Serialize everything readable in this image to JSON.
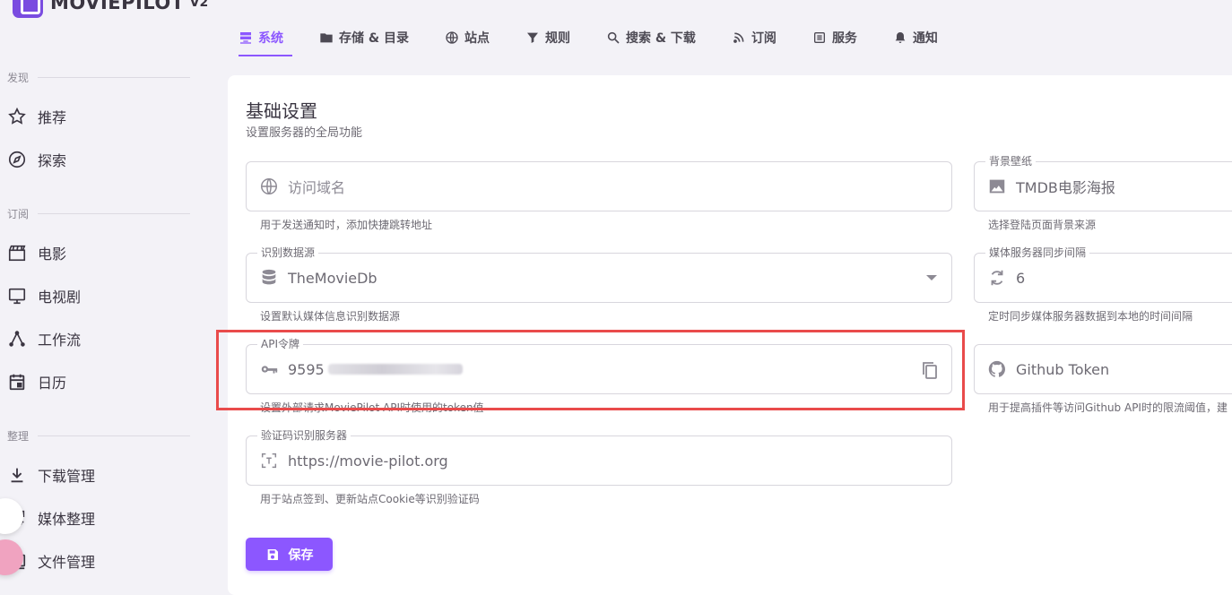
{
  "brand": {
    "name": "MOVIEPILOT",
    "version": "V2"
  },
  "sidebar": {
    "sections": [
      {
        "label": "发现"
      },
      {
        "label": "订阅"
      },
      {
        "label": "整理"
      }
    ],
    "items": [
      {
        "label": "推荐",
        "icon": "star-icon"
      },
      {
        "label": "探索",
        "icon": "compass-icon"
      },
      {
        "label": "电影",
        "icon": "clapper-icon"
      },
      {
        "label": "电视剧",
        "icon": "tv-icon"
      },
      {
        "label": "工作流",
        "icon": "workflow-icon"
      },
      {
        "label": "日历",
        "icon": "calendar-icon"
      },
      {
        "label": "下载管理",
        "icon": "download-icon"
      },
      {
        "label": "媒体整理",
        "icon": "organize-icon"
      },
      {
        "label": "文件管理",
        "icon": "file-manager-icon"
      }
    ]
  },
  "tabs": [
    {
      "label": "系统",
      "active": true
    },
    {
      "label": "存储 & 目录"
    },
    {
      "label": "站点"
    },
    {
      "label": "规则"
    },
    {
      "label": "搜索 & 下载"
    },
    {
      "label": "订阅"
    },
    {
      "label": "服务"
    },
    {
      "label": "通知"
    }
  ],
  "card": {
    "title": "基础设置",
    "subtitle": "设置服务器的全局功能"
  },
  "fields": {
    "domain": {
      "placeholder": "访问域名",
      "hint": "用于发送通知时，添加快捷跳转地址"
    },
    "wallpaper": {
      "label": "背景壁纸",
      "value": "TMDB电影海报",
      "hint": "选择登陆页面背景来源"
    },
    "datasource": {
      "label": "识别数据源",
      "value": "TheMovieDb",
      "hint": "设置默认媒体信息识别数据源"
    },
    "sync_interval": {
      "label": "媒体服务器同步间隔",
      "value": "6",
      "hint": "定时同步媒体服务器数据到本地的时间间隔"
    },
    "api_token": {
      "label": "API令牌",
      "value": "9595",
      "hint": "设置外部请求MoviePilot API时使用的token值"
    },
    "github_token": {
      "placeholder": "Github Token",
      "hint": "用于提高插件等访问Github API时的限流阈值，建"
    },
    "ocr_server": {
      "label": "验证码识别服务器",
      "value": "https://movie-pilot.org",
      "hint": "用于站点签到、更新站点Cookie等识别验证码"
    }
  },
  "save_button": {
    "label": "保存"
  },
  "colors": {
    "accent": "#8c57ff",
    "highlight": "#e94b4b"
  }
}
